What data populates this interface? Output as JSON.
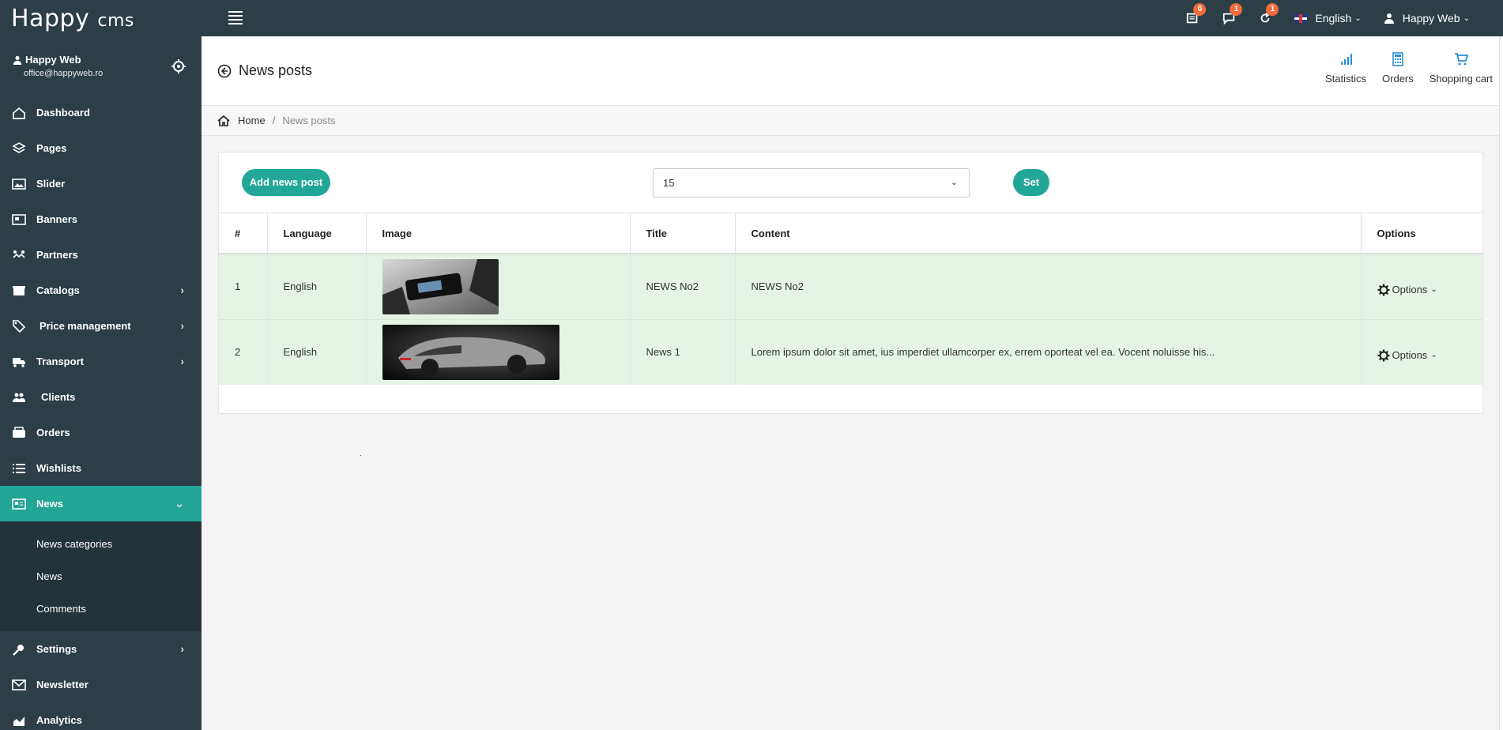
{
  "app": {
    "logo_main": "Happy",
    "logo_suffix": "cms"
  },
  "topbar": {
    "notifications": [
      {
        "icon": "news-icon",
        "count": "0"
      },
      {
        "icon": "comments-icon",
        "count": "1"
      },
      {
        "icon": "refresh-icon",
        "count": "1"
      }
    ],
    "language": "English",
    "user": "Happy Web"
  },
  "sidebar": {
    "user_name": "Happy Web",
    "user_email": "office@happyweb.ro",
    "items": [
      {
        "label": "Dashboard",
        "icon": "home-icon"
      },
      {
        "label": "Pages",
        "icon": "layers-icon"
      },
      {
        "label": "Slider",
        "icon": "image-icon"
      },
      {
        "label": "Banners",
        "icon": "banner-icon"
      },
      {
        "label": "Partners",
        "icon": "partners-icon"
      },
      {
        "label": "Catalogs",
        "icon": "catalog-icon"
      },
      {
        "label": "Price management",
        "icon": "tags-icon"
      },
      {
        "label": "Transport",
        "icon": "truck-icon"
      },
      {
        "label": "Clients",
        "icon": "users-icon"
      },
      {
        "label": "Orders",
        "icon": "orders-icon"
      },
      {
        "label": "Wishlists",
        "icon": "list-icon"
      },
      {
        "label": "News",
        "icon": "newspaper-icon"
      },
      {
        "label": "Settings",
        "icon": "settings-icon"
      },
      {
        "label": "Newsletter",
        "icon": "mail-icon"
      },
      {
        "label": "Analytics",
        "icon": "analytics-icon"
      }
    ],
    "news_sub": [
      {
        "label": "News categories"
      },
      {
        "label": "News"
      },
      {
        "label": "Comments"
      }
    ]
  },
  "header": {
    "title": "News posts",
    "links": [
      {
        "label": "Statistics",
        "icon": "bar-chart-icon"
      },
      {
        "label": "Orders",
        "icon": "calculator-icon"
      },
      {
        "label": "Shopping cart",
        "icon": "cart-icon"
      }
    ]
  },
  "breadcrumb": {
    "home": "Home",
    "separator": "/",
    "current": "News posts"
  },
  "toolbar": {
    "add_label": "Add news post",
    "per_page": "15",
    "set_label": "Set"
  },
  "table": {
    "columns": [
      "#",
      "Language",
      "Image",
      "Title",
      "Content",
      "Options"
    ],
    "rows": [
      {
        "num": "1",
        "language": "English",
        "title": "NEWS No2",
        "content": "NEWS No2",
        "options": "Options"
      },
      {
        "num": "2",
        "language": "English",
        "title": "News 1",
        "content": "Lorem ipsum dolor sit amet, ius imperdiet ullamcorper ex, errem oporteat vel ea. Vocent noluisse his...",
        "options": "Options"
      }
    ]
  },
  "colors": {
    "sidebar_bg": "#2c3e46",
    "accent": "#22a698",
    "badge": "#f26c3b",
    "row_bg": "#e6f4e6"
  }
}
